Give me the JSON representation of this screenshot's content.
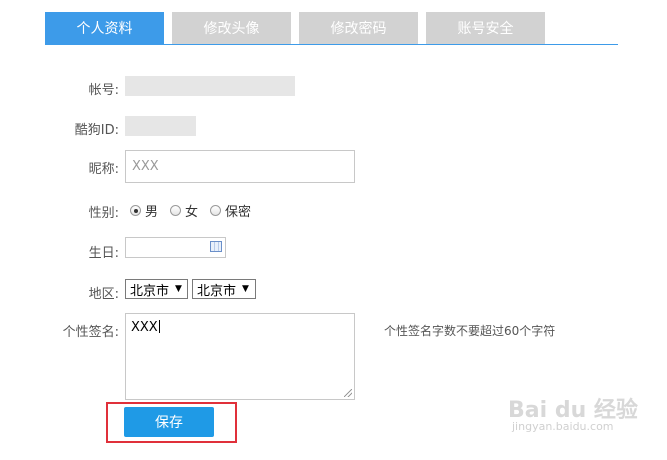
{
  "tabs": [
    {
      "label": "个人资料",
      "active": true
    },
    {
      "label": "修改头像",
      "active": false
    },
    {
      "label": "修改密码",
      "active": false
    },
    {
      "label": "账号安全",
      "active": false
    }
  ],
  "form": {
    "account_label": "帐号:",
    "kugou_id_label": "酷狗ID:",
    "nickname_label": "昵称:",
    "nickname_placeholder": "XXX",
    "gender_label": "性别:",
    "gender_options": [
      "男",
      "女",
      "保密"
    ],
    "gender_selected": "男",
    "birthday_label": "生日:",
    "birthday_value": "",
    "region_label": "地区:",
    "province_selected": "北京市",
    "city_selected": "北京市",
    "signature_label": "个性签名:",
    "signature_value": "XXX",
    "signature_hint": "个性签名字数不要超过60个字符",
    "save_label": "保存"
  },
  "watermark": {
    "logo_text": "Bai du 经验",
    "url": "jingyan.baidu.com"
  },
  "colors": {
    "accent": "#3d9be9",
    "tab_inactive": "#d2d2d2",
    "save_button": "#1f9ae6",
    "highlight_box": "#e0303a"
  }
}
